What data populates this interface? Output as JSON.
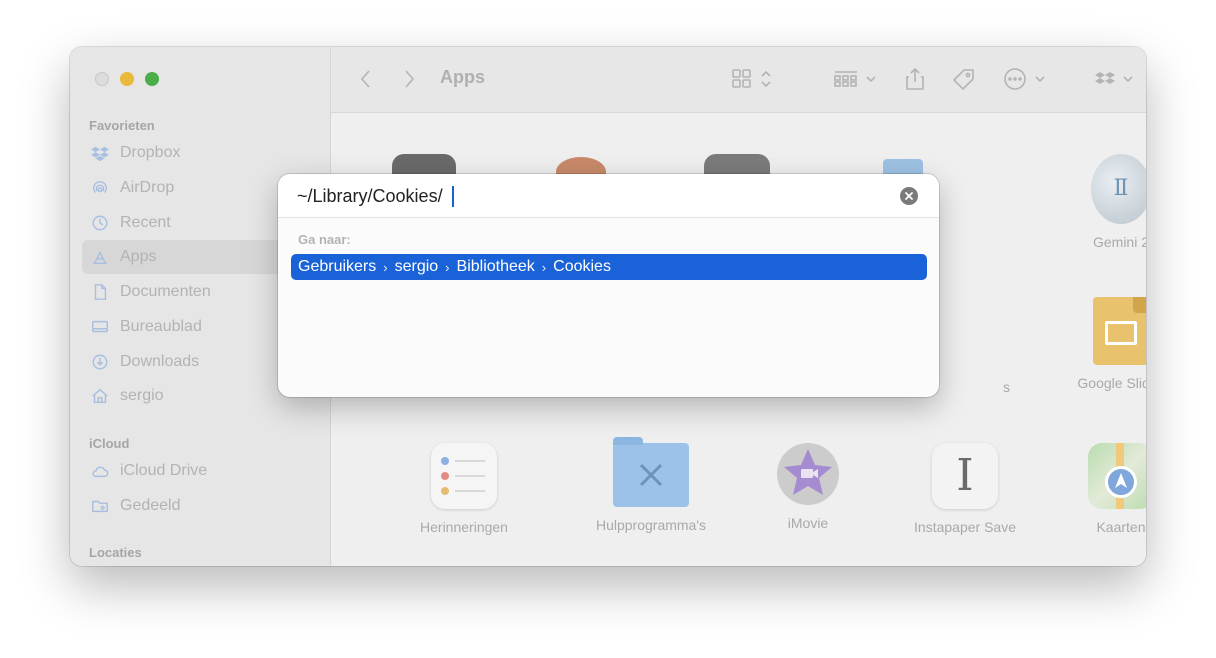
{
  "window": {
    "title": "Apps"
  },
  "sidebar": {
    "sections": [
      {
        "title": "Favorieten"
      },
      {
        "title": "iCloud"
      },
      {
        "title": "Locaties"
      }
    ],
    "items": [
      {
        "label": "Dropbox",
        "icon": "dropbox-icon"
      },
      {
        "label": "AirDrop",
        "icon": "airdrop-icon"
      },
      {
        "label": "Recent",
        "icon": "clock-icon"
      },
      {
        "label": "Apps",
        "icon": "apps-icon"
      },
      {
        "label": "Documenten",
        "icon": "document-icon"
      },
      {
        "label": "Bureaublad",
        "icon": "desktop-icon"
      },
      {
        "label": "Downloads",
        "icon": "download-icon"
      },
      {
        "label": "sergio",
        "icon": "home-icon"
      },
      {
        "label": "iCloud Drive",
        "icon": "cloud-icon"
      },
      {
        "label": "Gedeeld",
        "icon": "shared-folder-icon"
      }
    ]
  },
  "apps": [
    {
      "label": "Gemini 2"
    },
    {
      "label": "Google Slides"
    },
    {
      "label": "Herinneringen"
    },
    {
      "label": "Hulpprogramma's"
    },
    {
      "label": "iMovie"
    },
    {
      "label": "Instapaper Save"
    },
    {
      "label": "Kaarten"
    },
    {
      "label": "s"
    }
  ],
  "dialog": {
    "path_value": "~/Library/Cookies/",
    "goto_label": "Ga naar:",
    "suggestion": [
      "Gebruikers",
      "sergio",
      "Bibliotheek",
      "Cookies"
    ],
    "separator": "›"
  },
  "colors": {
    "accent": "#1a62d8"
  }
}
